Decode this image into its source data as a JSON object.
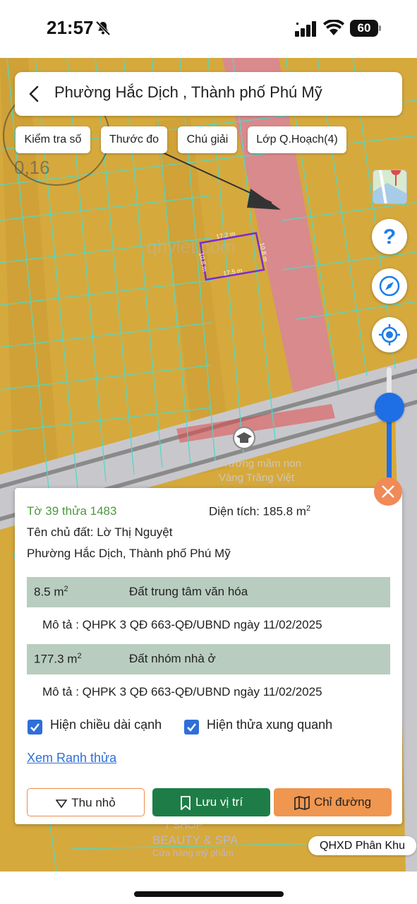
{
  "status_bar": {
    "time": "21:57",
    "battery": "60"
  },
  "header": {
    "title": "Phường Hắc Dịch , Thành phố Phú Mỹ"
  },
  "chips": [
    "Kiểm tra số",
    "Thước đo",
    "Chú giải",
    "Lớp Q.Hoạch(4)"
  ],
  "map": {
    "edges": {
      "top": "17.2 m",
      "right": "10.8 m",
      "bottom": "17.5 m",
      "left": "10.8 m"
    },
    "watermark": "qhviet.com",
    "poi_label_1": "Trường mầm non",
    "poi_label_2": "Vàng Trăng Việt",
    "shop_1": "T SHOP",
    "shop_2": "BEAUTY & SPA",
    "shop_3": "Cửa hàng mỹ phẩm",
    "plan_note": "0,16",
    "zoom_level": 0.72,
    "colors": {
      "residential": "#d6a93c",
      "culture": "#d98a8c",
      "road": "#c8c8cc",
      "parcel_lines": "#4fd9c8",
      "selected": "#7a2bd6"
    }
  },
  "panel": {
    "parcel_id": "Tờ 39 thửa 1483",
    "area_label": "Diện tích: 185.8 m",
    "area_sup": "2",
    "owner": "Tên chủ đất: Lờ Thị Nguyệt",
    "address": "Phường Hắc Dịch, Thành phố Phú Mỹ",
    "rows": [
      {
        "area": "8.5 m",
        "sup": "2",
        "use": "Đất trung tâm văn hóa",
        "desc": "Mô tả : QHPK 3 QĐ 663-QĐ/UBND ngày 11/02/2025"
      },
      {
        "area": "177.3 m",
        "sup": "2",
        "use": "Đất nhóm nhà ở",
        "desc": "Mô tả : QHPK 3 QĐ 663-QĐ/UBND ngày 11/02/2025"
      }
    ],
    "checkbox_1": "Hiện chiều dài cạnh",
    "checkbox_2": "Hiện thửa xung quanh",
    "link": "Xem Ranh thửa",
    "buttons": {
      "collapse": "Thu nhỏ",
      "save": "Lưu vị trí",
      "directions": "Chỉ đường"
    }
  },
  "layer_badge": "QHXD Phân Khu"
}
